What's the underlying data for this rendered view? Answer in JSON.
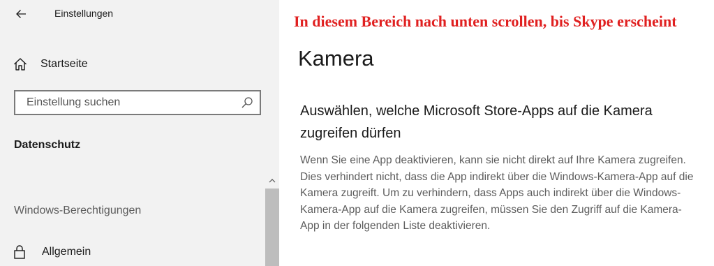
{
  "sidebar": {
    "app_title": "Einstellungen",
    "home_label": "Startseite",
    "search": {
      "placeholder": "Einstellung suchen",
      "value": ""
    },
    "group_label": "Datenschutz",
    "section_label": "Windows-Berechtigungen",
    "items": [
      {
        "label": "Allgemein",
        "icon": "lock-icon"
      }
    ]
  },
  "main": {
    "annotation": "In diesem Bereich nach unten scrollen, bis Skype erscheint",
    "page_title": "Kamera",
    "subheading": "Auswählen, welche Microsoft Store-Apps auf die Kamera zugreifen dürfen",
    "description": "Wenn Sie eine App deaktivieren, kann sie nicht direkt auf Ihre Kamera zugreifen. Dies verhindert nicht, dass die App indirekt über die Windows-Kamera-App auf die Kamera zugreift. Um zu verhindern, dass Apps auch indirekt über die Windows-Kamera-App auf die Kamera zugreifen, müssen Sie den Zugriff auf die Kamera-App in der folgenden Liste deaktivieren."
  },
  "colors": {
    "sidebar_bg": "#f2f2f2",
    "annotation_text": "#e02020",
    "secondary_text": "#5d5d5d",
    "scrollbar_thumb": "#bdbdbd"
  }
}
